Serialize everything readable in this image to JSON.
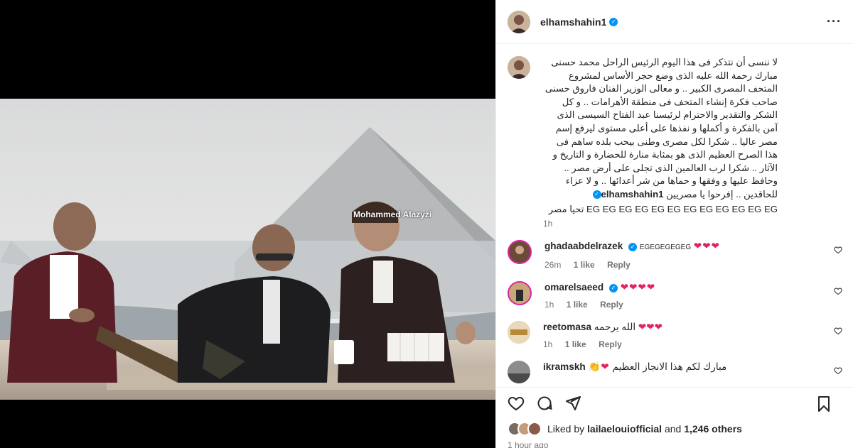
{
  "post": {
    "watermark": "Mohammed Alazyzi"
  },
  "header": {
    "username": "elhamshahin1",
    "verified": true,
    "more_icon": "more-horizontal-icon"
  },
  "caption": {
    "username": "elhamshahin1",
    "text": "لا ننسى أن نتذكر فى هذا اليوم الرئيس الراحل محمد حسنى مبارك رحمة الله عليه الذى وضع حجر الأساس لمشروع المتحف المصرى الكبير .. و معالى الوزير الفنان فاروق حسنى صاحب فكرة إنشاء المتحف فى منطقة الأهرامات .. و كل الشكر والتقدير والاحترام لرئيسنا عبد الفتاح السيسى الذى آمن بالفكرة و أكملها و نفذها على أعلى مستوى ليرفع إسم مصر عاليا .. شكرا لكل مصرى وطنى بيحب بلده ساهم فى هذا الصرح العظيم الذى هو بمثابة منارة للحضارة و التاريخ و الآثار .. شكرا لرب العالمين الذى تجلى على أرض مصر .. وحافظ عليها و وفقها و حماها من شر أعدائها .. و لا عزاء للحاقدين .. إفرحوا يا مصريين",
    "line2": "EG EG EG EG EG EG EG EG EG EG EG EG تحيا مصر",
    "time": "1h"
  },
  "comments": [
    {
      "username": "ghadaabdelrazek",
      "verified": true,
      "text": "EGEGEGEGEG",
      "hearts": "❤❤❤",
      "time": "26m",
      "likes": "1 like",
      "reply": "Reply"
    },
    {
      "username": "omarelsaeed",
      "verified": true,
      "text": "",
      "hearts": "❤❤❤❤",
      "time": "1h",
      "likes": "1 like",
      "reply": "Reply"
    },
    {
      "username": "reetomasa",
      "verified": false,
      "text": "الله يرحمه",
      "hearts": "❤❤❤",
      "time": "1h",
      "likes": "1 like",
      "reply": "Reply"
    },
    {
      "username": "ikramskh",
      "verified": false,
      "text": "مبارك لكم هذا الانجاز العظيم",
      "hearts": "👏❤",
      "time": "",
      "likes": "",
      "reply": ""
    }
  ],
  "likes": {
    "prefix": "Liked by",
    "user": "lailaelouiofficial",
    "and": "and",
    "count": "1,246 others"
  },
  "posted_ago": "1 hour ago",
  "colors": {
    "verified": "#0095f6",
    "heart": "#e0245e",
    "muted": "#737373"
  }
}
